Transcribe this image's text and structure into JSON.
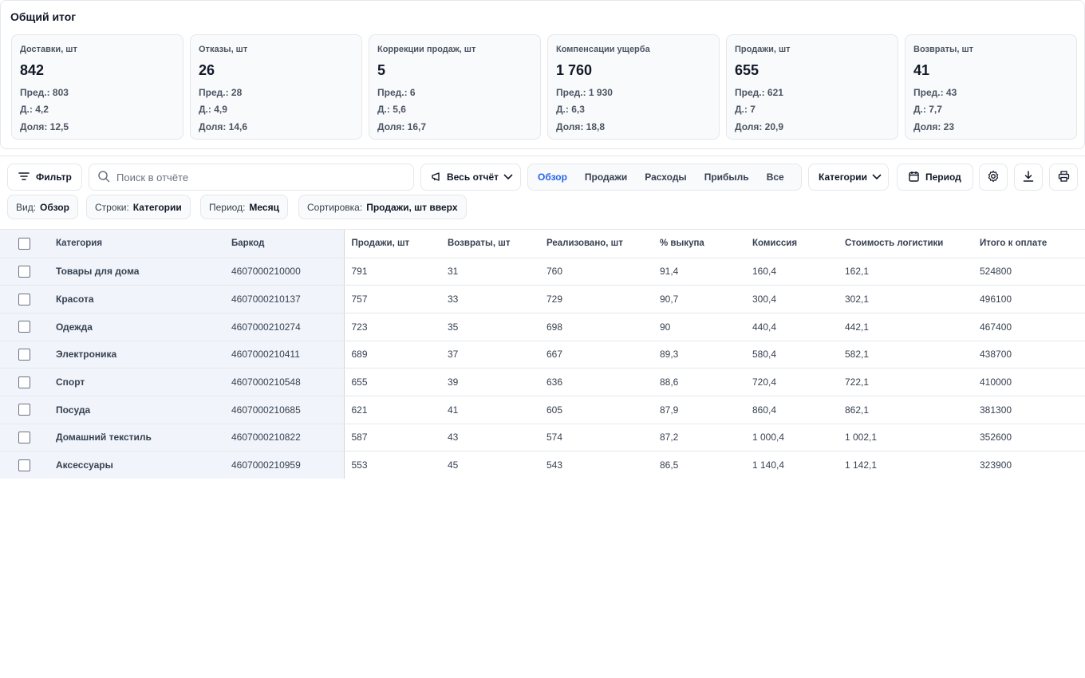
{
  "summary": {
    "title": "Общий итог",
    "cards": [
      {
        "label": "Доставки, шт",
        "value": "842",
        "prev": "Пред.: 803",
        "delta": "Д.: 4,2",
        "share": "Доля: 12,5"
      },
      {
        "label": "Отказы, шт",
        "value": "26",
        "prev": "Пред.: 28",
        "delta": "Д.: 4,9",
        "share": "Доля: 14,6"
      },
      {
        "label": "Коррекции продаж, шт",
        "value": "5",
        "prev": "Пред.: 6",
        "delta": "Д.: 5,6",
        "share": "Доля: 16,7"
      },
      {
        "label": "Компенсации ущерба",
        "value": "1 760",
        "prev": "Пред.: 1 930",
        "delta": "Д.: 6,3",
        "share": "Доля: 18,8"
      },
      {
        "label": "Продажи, шт",
        "value": "655",
        "prev": "Пред.: 621",
        "delta": "Д.: 7",
        "share": "Доля: 20,9"
      },
      {
        "label": "Возвраты, шт",
        "value": "41",
        "prev": "Пред.: 43",
        "delta": "Д.: 7,7",
        "share": "Доля: 23"
      }
    ]
  },
  "toolbar": {
    "filter_label": "Фильтр",
    "search_placeholder": "Поиск в отчёте",
    "scope_label": "Весь отчёт",
    "tabs": [
      "Обзор",
      "Продажи",
      "Расходы",
      "Прибыль",
      "Все"
    ],
    "active_tab": "Обзор",
    "categories_label": "Категории",
    "period_label": "Период"
  },
  "chips": [
    {
      "key": "Вид:",
      "value": "Обзор"
    },
    {
      "key": "Строки:",
      "value": "Категории"
    },
    {
      "key": "Период:",
      "value": "Месяц"
    },
    {
      "key": "Сортировка:",
      "value": "Продажи, шт вверх"
    }
  ],
  "table": {
    "columns": [
      "Категория",
      "Баркод",
      "Продажи, шт",
      "Возвраты, шт",
      "Реализовано, шт",
      "% выкупа",
      "Комиссия",
      "Стоимость логистики",
      "Итого к оплате"
    ],
    "rows": [
      [
        "Товары для дома",
        "4607000210000",
        "791",
        "31",
        "760",
        "91,4",
        "160,4",
        "162,1",
        "524800"
      ],
      [
        "Красота",
        "4607000210137",
        "757",
        "33",
        "729",
        "90,7",
        "300,4",
        "302,1",
        "496100"
      ],
      [
        "Одежда",
        "4607000210274",
        "723",
        "35",
        "698",
        "90",
        "440,4",
        "442,1",
        "467400"
      ],
      [
        "Электроника",
        "4607000210411",
        "689",
        "37",
        "667",
        "89,3",
        "580,4",
        "582,1",
        "438700"
      ],
      [
        "Спорт",
        "4607000210548",
        "655",
        "39",
        "636",
        "88,6",
        "720,4",
        "722,1",
        "410000"
      ],
      [
        "Посуда",
        "4607000210685",
        "621",
        "41",
        "605",
        "87,9",
        "860,4",
        "862,1",
        "381300"
      ],
      [
        "Домашний текстиль",
        "4607000210822",
        "587",
        "43",
        "574",
        "87,2",
        "1 000,4",
        "1 002,1",
        "352600"
      ],
      [
        "Аксессуары",
        "4607000210959",
        "553",
        "45",
        "543",
        "86,5",
        "1 140,4",
        "1 142,1",
        "323900"
      ]
    ]
  }
}
